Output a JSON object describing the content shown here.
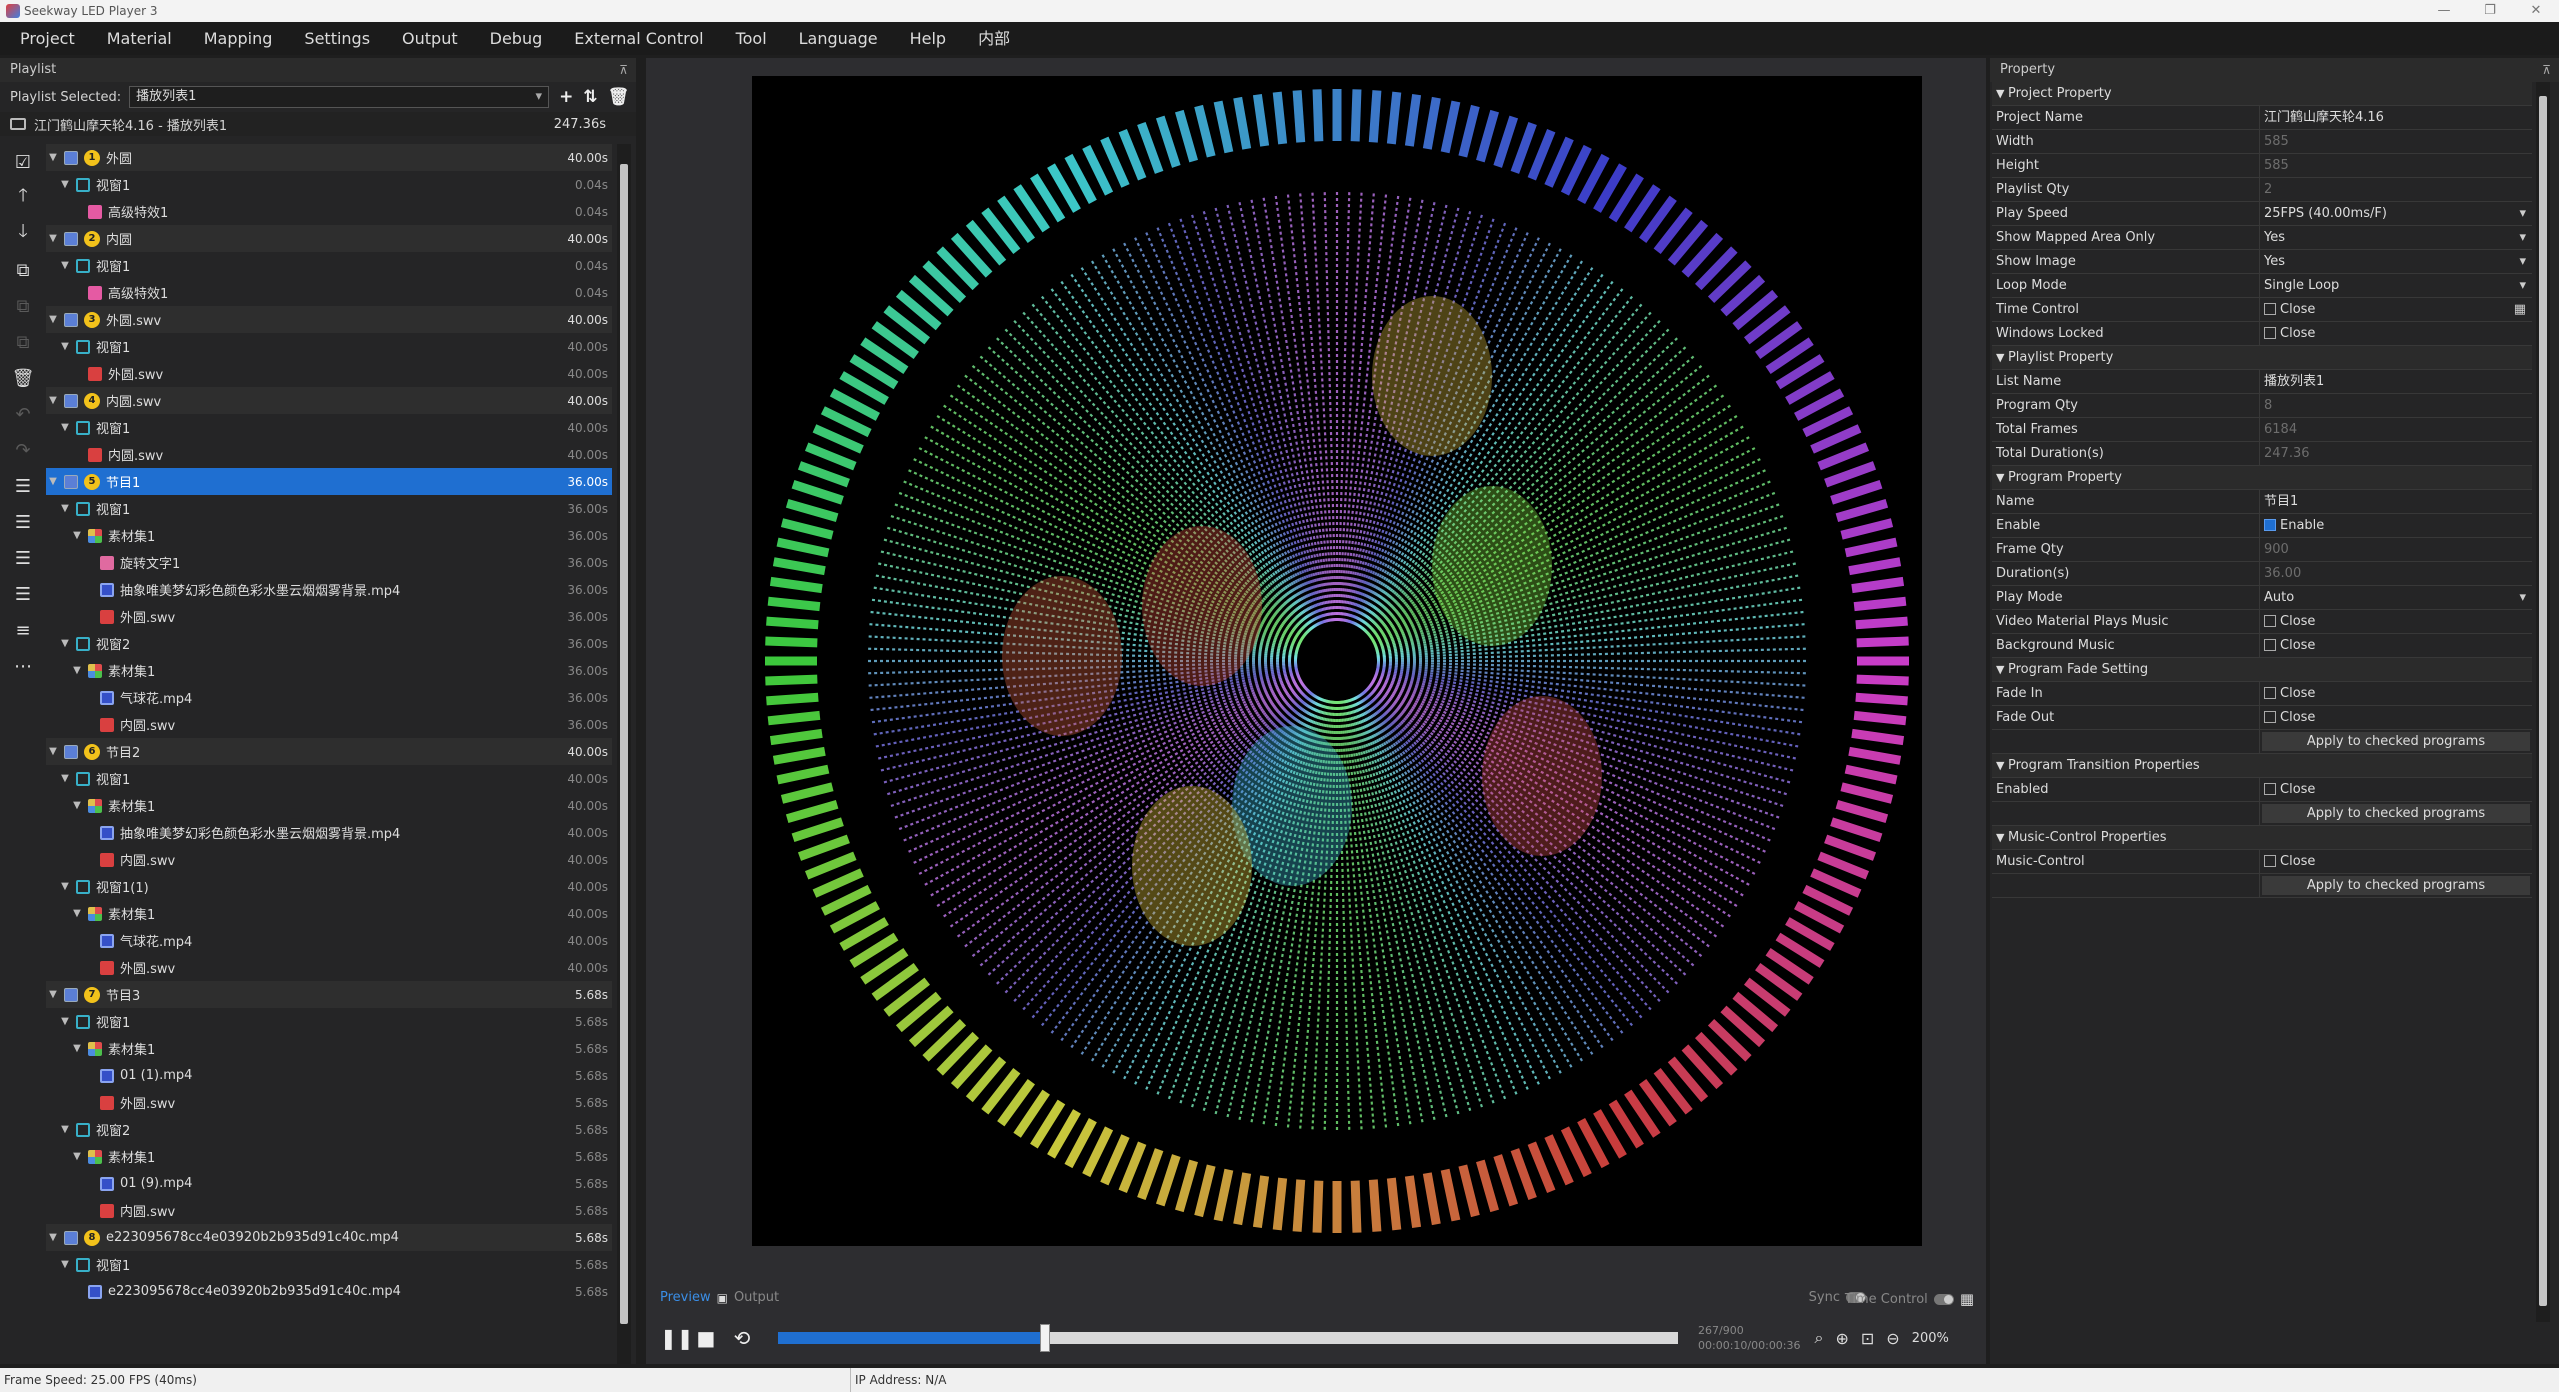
{
  "window": {
    "title": "Seekway LED Player 3"
  },
  "menu": [
    "Project",
    "Material",
    "Mapping",
    "Settings",
    "Output",
    "Debug",
    "External Control",
    "Tool",
    "Language",
    "Help",
    "内部"
  ],
  "playlist_panel": {
    "title": "Playlist",
    "selected_label": "Playlist Selected:",
    "selected_value": "播放列表1",
    "project_row": {
      "label": "江门鹤山摩天轮4.16 - 播放列表1",
      "duration": "247.36s"
    },
    "rows": [
      {
        "lvl": 0,
        "num": "1",
        "icon": "prog",
        "label": "外圆",
        "dur": "40.00s"
      },
      {
        "lvl": 1,
        "icon": "win",
        "label": "视窗1",
        "dur": "0.04s"
      },
      {
        "lvl": 2,
        "icon": "fx",
        "label": "高级特效1",
        "dur": "0.04s"
      },
      {
        "lvl": 0,
        "num": "2",
        "icon": "prog",
        "label": "内圆",
        "dur": "40.00s"
      },
      {
        "lvl": 1,
        "icon": "win",
        "label": "视窗1",
        "dur": "0.04s"
      },
      {
        "lvl": 2,
        "icon": "fx",
        "label": "高级特效1",
        "dur": "0.04s"
      },
      {
        "lvl": 0,
        "num": "3",
        "icon": "prog",
        "label": "外圆.swv",
        "dur": "40.00s"
      },
      {
        "lvl": 1,
        "icon": "win",
        "label": "视窗1",
        "dur": "40.00s"
      },
      {
        "lvl": 2,
        "icon": "swv",
        "label": "外圆.swv",
        "dur": "40.00s"
      },
      {
        "lvl": 0,
        "num": "4",
        "icon": "prog",
        "label": "内圆.swv",
        "dur": "40.00s"
      },
      {
        "lvl": 1,
        "icon": "win",
        "label": "视窗1",
        "dur": "40.00s"
      },
      {
        "lvl": 2,
        "icon": "swv",
        "label": "内圆.swv",
        "dur": "40.00s"
      },
      {
        "lvl": 0,
        "num": "5",
        "icon": "prog",
        "label": "节目1",
        "dur": "36.00s",
        "sel": true
      },
      {
        "lvl": 1,
        "icon": "win",
        "label": "视窗1",
        "dur": "36.00s"
      },
      {
        "lvl": 2,
        "icon": "set",
        "label": "素材集1",
        "dur": "36.00s"
      },
      {
        "lvl": 3,
        "icon": "txt",
        "label": "旋转文字1",
        "dur": "36.00s"
      },
      {
        "lvl": 3,
        "icon": "vid",
        "label": "抽象唯美梦幻彩色颜色彩水墨云烟烟雾背景.mp4",
        "dur": "36.00s"
      },
      {
        "lvl": 3,
        "icon": "swv",
        "label": "外圆.swv",
        "dur": "36.00s"
      },
      {
        "lvl": 1,
        "icon": "win",
        "label": "视窗2",
        "dur": "36.00s"
      },
      {
        "lvl": 2,
        "icon": "set",
        "label": "素材集1",
        "dur": "36.00s"
      },
      {
        "lvl": 3,
        "icon": "vid",
        "label": "气球花.mp4",
        "dur": "36.00s"
      },
      {
        "lvl": 3,
        "icon": "swv",
        "label": "内圆.swv",
        "dur": "36.00s"
      },
      {
        "lvl": 0,
        "num": "6",
        "icon": "prog",
        "label": "节目2",
        "dur": "40.00s"
      },
      {
        "lvl": 1,
        "icon": "win",
        "label": "视窗1",
        "dur": "40.00s"
      },
      {
        "lvl": 2,
        "icon": "set",
        "label": "素材集1",
        "dur": "40.00s"
      },
      {
        "lvl": 3,
        "icon": "vid",
        "label": "抽象唯美梦幻彩色颜色彩水墨云烟烟雾背景.mp4",
        "dur": "40.00s"
      },
      {
        "lvl": 3,
        "icon": "swv",
        "label": "内圆.swv",
        "dur": "40.00s"
      },
      {
        "lvl": 1,
        "icon": "win",
        "label": "视窗1(1)",
        "dur": "40.00s"
      },
      {
        "lvl": 2,
        "icon": "set",
        "label": "素材集1",
        "dur": "40.00s"
      },
      {
        "lvl": 3,
        "icon": "vid",
        "label": "气球花.mp4",
        "dur": "40.00s"
      },
      {
        "lvl": 3,
        "icon": "swv",
        "label": "外圆.swv",
        "dur": "40.00s"
      },
      {
        "lvl": 0,
        "num": "7",
        "icon": "prog",
        "label": "节目3",
        "dur": "5.68s"
      },
      {
        "lvl": 1,
        "icon": "win",
        "label": "视窗1",
        "dur": "5.68s"
      },
      {
        "lvl": 2,
        "icon": "set",
        "label": "素材集1",
        "dur": "5.68s"
      },
      {
        "lvl": 3,
        "icon": "vid",
        "label": "01 (1).mp4",
        "dur": "5.68s"
      },
      {
        "lvl": 3,
        "icon": "swv",
        "label": "外圆.swv",
        "dur": "5.68s"
      },
      {
        "lvl": 1,
        "icon": "win",
        "label": "视窗2",
        "dur": "5.68s"
      },
      {
        "lvl": 2,
        "icon": "set",
        "label": "素材集1",
        "dur": "5.68s"
      },
      {
        "lvl": 3,
        "icon": "vid",
        "label": "01 (9).mp4",
        "dur": "5.68s"
      },
      {
        "lvl": 3,
        "icon": "swv",
        "label": "内圆.swv",
        "dur": "5.68s"
      },
      {
        "lvl": 0,
        "num": "8",
        "icon": "prog",
        "label": "e223095678cc4e03920b2b935d91c40c.mp4",
        "dur": "5.68s"
      },
      {
        "lvl": 1,
        "icon": "win",
        "label": "视窗1",
        "dur": "5.68s"
      },
      {
        "lvl": 2,
        "icon": "vid",
        "label": "e223095678cc4e03920b2b935d91c40c.mp4",
        "dur": "5.68s"
      }
    ]
  },
  "preview": {
    "tab_preview": "Preview",
    "tab_output": "Output",
    "sync_label": "Sync",
    "time_control_label": "Time Control",
    "frame_counter": "267/900",
    "time_counter": "00:00:10/00:00:36",
    "progress_fraction": 0.297,
    "zoom": "200%"
  },
  "property_panel": {
    "title": "Property",
    "sections": [
      {
        "title": "Project Property",
        "rows": [
          {
            "k": "Project Name",
            "v": "江门鹤山摩天轮4.16"
          },
          {
            "k": "Width",
            "v": "585",
            "ro": true
          },
          {
            "k": "Height",
            "v": "585",
            "ro": true
          },
          {
            "k": "Playlist Qty",
            "v": "2",
            "ro": true
          },
          {
            "k": "Play Speed",
            "v": "25FPS (40.00ms/F)",
            "dd": true
          },
          {
            "k": "Show Mapped Area Only",
            "v": "Yes",
            "dd": true
          },
          {
            "k": "Show Image",
            "v": "Yes",
            "dd": true
          },
          {
            "k": "Loop Mode",
            "v": "Single Loop",
            "dd": true
          },
          {
            "k": "Time Control",
            "v": "Close",
            "cb": false
          },
          {
            "k": "Windows Locked",
            "v": "Close",
            "cb": false
          }
        ]
      },
      {
        "title": "Playlist Property",
        "rows": [
          {
            "k": "List Name",
            "v": "播放列表1"
          },
          {
            "k": "Program Qty",
            "v": "8",
            "ro": true
          },
          {
            "k": "Total Frames",
            "v": "6184",
            "ro": true
          },
          {
            "k": "Total Duration(s)",
            "v": "247.36",
            "ro": true
          }
        ]
      },
      {
        "title": "Program Property",
        "rows": [
          {
            "k": "Name",
            "v": "节目1"
          },
          {
            "k": "Enable",
            "v": "Enable",
            "cb": true
          },
          {
            "k": "Frame Qty",
            "v": "900",
            "ro": true
          },
          {
            "k": "Duration(s)",
            "v": "36.00",
            "ro": true
          },
          {
            "k": "Play Mode",
            "v": "Auto",
            "dd": true
          },
          {
            "k": "Video Material Plays Music",
            "v": "Close",
            "cb": false
          },
          {
            "k": "Background Music",
            "v": "Close",
            "cb": false
          }
        ]
      },
      {
        "title": "Program Fade Setting",
        "rows": [
          {
            "k": "Fade In",
            "v": "Close",
            "cb": false
          },
          {
            "k": "Fade Out",
            "v": "Close",
            "cb": false
          }
        ],
        "apply": "Apply to checked programs"
      },
      {
        "title": "Program Transition Properties",
        "rows": [
          {
            "k": "Enabled",
            "v": "Close",
            "cb": false
          }
        ],
        "apply": "Apply to checked programs"
      },
      {
        "title": "Music-Control Properties",
        "rows": [
          {
            "k": "Music-Control",
            "v": "Close",
            "cb": false
          }
        ],
        "apply": "Apply to checked programs"
      }
    ]
  },
  "status": {
    "frame_speed": "Frame Speed: 25.00 FPS (40ms)",
    "ip": "IP Address: N/A"
  },
  "colors": {
    "accent": "#1f6fd1",
    "panel": "#252526",
    "canvas": "#000000"
  }
}
